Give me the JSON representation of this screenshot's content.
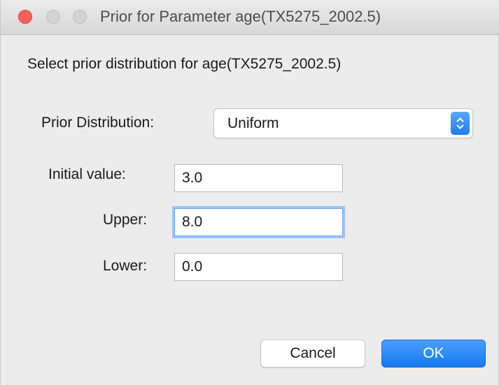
{
  "window": {
    "title": "Prior for Parameter age(TX5275_2002.5)"
  },
  "prompt": "Select prior distribution for age(TX5275_2002.5)",
  "distribution": {
    "label": "Prior Distribution:",
    "selected": "Uniform"
  },
  "fields": {
    "initial": {
      "label": "Initial value:",
      "value": "3.0"
    },
    "upper": {
      "label": "Upper:",
      "value": "8.0",
      "focused": true
    },
    "lower": {
      "label": "Lower:",
      "value": "0.0"
    }
  },
  "buttons": {
    "cancel": "Cancel",
    "ok": "OK"
  },
  "colors": {
    "close": "#fc5f57",
    "accent": "#1c7cf0",
    "focus_ring": "#9cc4f6"
  }
}
